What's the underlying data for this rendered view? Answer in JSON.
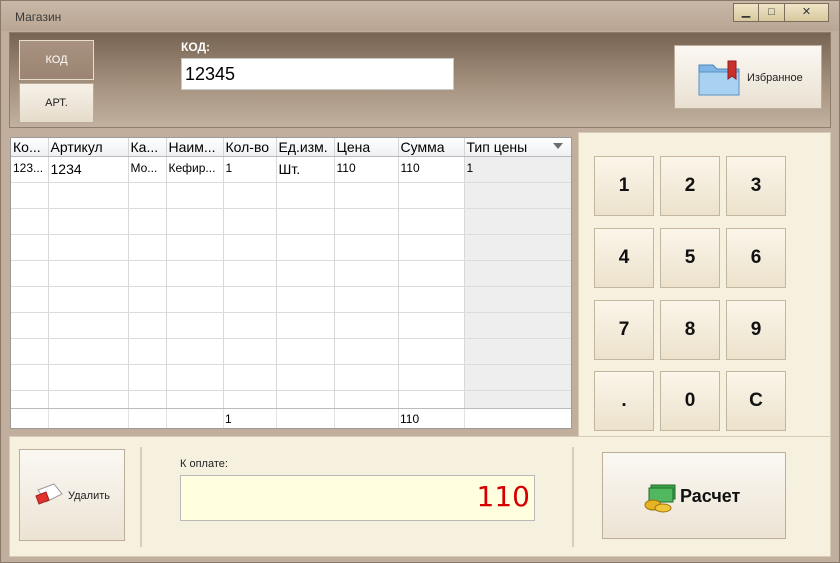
{
  "window": {
    "title": "Магазин",
    "controls": {
      "minimize": "▁",
      "maximize": "□",
      "close": "✕"
    }
  },
  "top": {
    "code_button": "КОД",
    "article_button": "АРТ.",
    "code_label": "КОД:",
    "code_value": "12345",
    "favorites_button": "Избранное",
    "favorites_icon": "folder-bookmark-icon"
  },
  "table": {
    "columns": [
      "Ко...",
      "Артикул",
      "Ка...",
      "Наим...",
      "Кол-во",
      "Ед.изм.",
      "Цена",
      "Сумма",
      "Тип цены"
    ],
    "rows": [
      [
        "123...",
        "1234",
        "Мо...",
        "Кефир...",
        "1",
        "Шт.",
        "110",
        "110",
        "1"
      ]
    ],
    "empty_rows": 9,
    "totals": {
      "quantity": "1",
      "sum": "110"
    }
  },
  "numpad": {
    "keys": [
      "1",
      "2",
      "3",
      "4",
      "5",
      "6",
      "7",
      "8",
      "9",
      ".",
      "0",
      "C"
    ]
  },
  "bottom": {
    "delete_button": "Удалить",
    "delete_icon": "eraser-icon",
    "to_pay_label": "К оплате:",
    "to_pay_amount": "110",
    "checkout_button": "Расчет",
    "checkout_icon": "money-coins-icon"
  },
  "colors": {
    "accent_amount": "#d60000",
    "panel": "#f6f0df",
    "header": "#776452"
  }
}
